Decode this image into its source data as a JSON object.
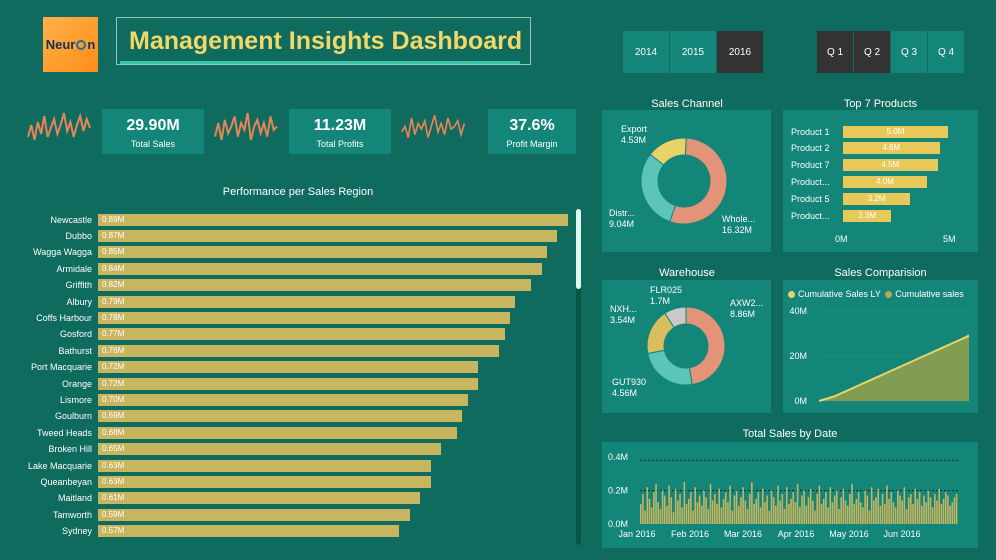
{
  "header": {
    "logo_text_left": "Neur",
    "logo_text_right": "n",
    "title": "Management Insights Dashboard"
  },
  "filters": {
    "years": [
      {
        "label": "2014",
        "selected": false
      },
      {
        "label": "2015",
        "selected": false
      },
      {
        "label": "2016",
        "selected": true
      }
    ],
    "quarters": [
      {
        "label": "Q 1",
        "selected": true
      },
      {
        "label": "Q 2",
        "selected": true
      },
      {
        "label": "Q 3",
        "selected": false
      },
      {
        "label": "Q 4",
        "selected": false
      }
    ]
  },
  "kpis": [
    {
      "value": "29.90M",
      "label": "Total Sales"
    },
    {
      "value": "11.23M",
      "label": "Total Profits"
    },
    {
      "value": "37.6%",
      "label": "Profit Margin"
    }
  ],
  "colors": {
    "background": "#0f6b5d",
    "card": "#138579",
    "bar_region": "#c8b560",
    "bar_product": "#e7c95a",
    "accent_title": "#f1d86a",
    "spark": "#e8845a"
  },
  "chart_data": [
    {
      "type": "bar",
      "title": "Performance per Sales Region",
      "orientation": "horizontal",
      "categories": [
        "Newcastle",
        "Dubbo",
        "Wagga Wagga",
        "Armidale",
        "Griffith",
        "Albury",
        "Coffs Harbour",
        "Gosford",
        "Bathurst",
        "Port Macquarie",
        "Orange",
        "Lismore",
        "Goulburn",
        "Tweed Heads",
        "Broken Hill",
        "Lake Macquarie",
        "Queanbeyan",
        "Maitland",
        "Tamworth",
        "Sydney"
      ],
      "values": [
        0.89,
        0.87,
        0.85,
        0.84,
        0.82,
        0.79,
        0.78,
        0.77,
        0.76,
        0.72,
        0.72,
        0.7,
        0.69,
        0.68,
        0.65,
        0.63,
        0.63,
        0.61,
        0.59,
        0.57
      ],
      "value_labels": [
        "0.89M",
        "0.87M",
        "0.85M",
        "0.84M",
        "0.82M",
        "0.79M",
        "0.78M",
        "0.77M",
        "0.76M",
        "0.72M",
        "0.72M",
        "0.70M",
        "0.69M",
        "0.68M",
        "0.65M",
        "0.63M",
        "0.63M",
        "0.61M",
        "0.59M",
        "0.57M"
      ]
    },
    {
      "type": "pie",
      "title": "Sales Channel",
      "categories": [
        "Wholesale",
        "Distributor",
        "Export"
      ],
      "display_labels": [
        "Whole...",
        "Distr...",
        "Export"
      ],
      "values": [
        16.32,
        9.04,
        4.53
      ],
      "value_labels": [
        "16.32M",
        "9.04M",
        "4.53M"
      ],
      "colors": [
        "#e39377",
        "#5cc4b8",
        "#e8d26a"
      ]
    },
    {
      "type": "bar",
      "title": "Top 7 Products",
      "orientation": "horizontal",
      "categories": [
        "Product 1",
        "Product 2",
        "Product 7",
        "Product...",
        "Product 5",
        "Product..."
      ],
      "values": [
        5.0,
        4.6,
        4.5,
        4.0,
        3.2,
        2.3
      ],
      "value_labels": [
        "5.0M",
        "4.6M",
        "4.5M",
        "4.0M",
        "3.2M",
        "2.3M"
      ],
      "xticks": [
        "0M",
        "5M"
      ],
      "xlim": [
        0,
        5
      ]
    },
    {
      "type": "pie",
      "title": "Warehouse",
      "categories": [
        "AXW291",
        "GUT930",
        "NXH382",
        "FLR025"
      ],
      "display_labels": [
        "AXW2...",
        "GUT930",
        "NXH...",
        "FLR025"
      ],
      "values": [
        8.86,
        4.56,
        3.54,
        1.7
      ],
      "value_labels": [
        "8.86M",
        "4.56M",
        "3.54M",
        "1.7M"
      ],
      "colors": [
        "#e39377",
        "#5cc4b8",
        "#d9be5e",
        "#c9c9c9"
      ]
    },
    {
      "type": "area",
      "title": "Sales Comparision",
      "legend": [
        "Cumulative Sales LY",
        "Cumulative sales"
      ],
      "legend_colors": [
        "#e8d26a",
        "#b8a84e"
      ],
      "yticks": [
        "0M",
        "20M",
        "40M"
      ],
      "ylim": [
        0,
        40
      ],
      "series": [
        {
          "name": "Cumulative Sales LY",
          "values": [
            0,
            2,
            5,
            8,
            11,
            14,
            17,
            20,
            23,
            26,
            29
          ]
        },
        {
          "name": "Cumulative sales",
          "values": [
            0,
            2,
            5,
            8,
            11,
            14,
            17,
            20,
            23,
            26,
            29.9
          ]
        }
      ]
    },
    {
      "type": "bar",
      "title": "Total Sales by Date",
      "xticks": [
        "Jan 2016",
        "Feb 2016",
        "Mar 2016",
        "Apr 2016",
        "May 2016",
        "Jun 2016"
      ],
      "yticks": [
        "0.0M",
        "0.2M",
        "0.4M"
      ],
      "ylim": [
        0,
        0.4
      ],
      "reference_lines": [
        0.38,
        0.2
      ],
      "values": [
        0.12,
        0.18,
        0.08,
        0.22,
        0.15,
        0.1,
        0.19,
        0.24,
        0.13,
        0.09,
        0.2,
        0.17,
        0.11,
        0.23,
        0.16,
        0.07,
        0.21,
        0.14,
        0.18,
        0.1,
        0.25,
        0.12,
        0.15,
        0.19,
        0.08,
        0.22,
        0.13,
        0.17,
        0.11,
        0.2,
        0.16,
        0.09,
        0.24,
        0.14,
        0.18,
        0.12,
        0.21,
        0.1,
        0.15,
        0.19,
        0.13,
        0.23,
        0.08,
        0.17,
        0.2,
        0.11,
        0.16,
        0.22,
        0.14,
        0.09,
        0.18,
        0.25,
        0.12,
        0.15,
        0.19,
        0.1,
        0.21,
        0.13,
        0.17,
        0.08,
        0.2,
        0.16,
        0.11,
        0.23,
        0.14,
        0.18,
        0.09,
        0.22,
        0.12,
        0.15,
        0.19,
        0.13,
        0.24,
        0.1,
        0.17,
        0.2,
        0.11,
        0.16,
        0.21,
        0.14,
        0.08,
        0.18,
        0.23,
        0.12,
        0.15,
        0.19,
        0.1,
        0.22,
        0.13,
        0.17,
        0.2,
        0.09,
        0.16,
        0.21,
        0.14,
        0.11,
        0.18,
        0.24,
        0.12,
        0.15,
        0.19,
        0.13,
        0.1,
        0.2,
        0.17,
        0.08,
        0.22,
        0.14,
        0.16,
        0.21,
        0.11,
        0.18,
        0.12,
        0.23,
        0.15,
        0.19,
        0.13,
        0.1,
        0.2,
        0.17,
        0.14,
        0.22,
        0.09,
        0.16,
        0.18,
        0.12,
        0.21,
        0.15,
        0.19,
        0.11,
        0.17,
        0.13,
        0.2,
        0.16,
        0.1,
        0.18,
        0.14,
        0.21,
        0.12,
        0.15,
        0.19,
        0.17,
        0.11,
        0.13,
        0.16,
        0.18
      ]
    }
  ],
  "sparklines": [
    [
      5,
      9,
      4,
      10,
      6,
      12,
      5,
      8,
      11,
      6,
      9,
      13,
      7,
      10,
      5,
      9,
      12,
      7,
      11,
      8
    ],
    [
      6,
      10,
      5,
      11,
      7,
      9,
      12,
      6,
      10,
      8,
      13,
      5,
      9,
      11,
      7,
      10,
      6,
      12,
      8,
      9
    ],
    [
      7,
      9,
      5,
      12,
      6,
      10,
      8,
      11,
      5,
      9,
      13,
      7,
      10,
      6,
      12,
      8,
      9,
      11,
      6,
      10
    ]
  ]
}
